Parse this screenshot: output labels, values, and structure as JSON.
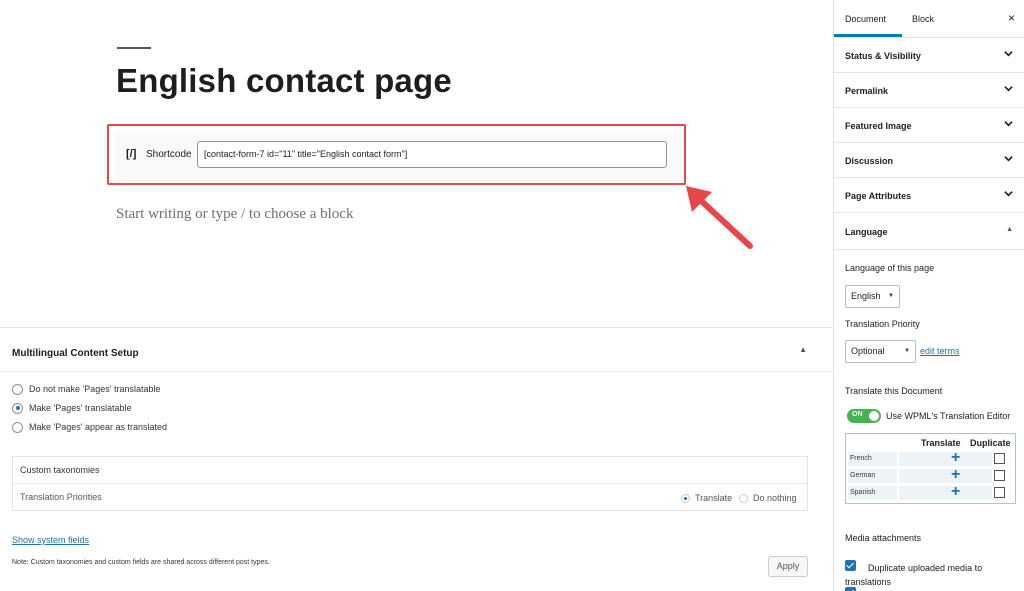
{
  "editor": {
    "post_title": "English contact page",
    "shortcode": {
      "icon": "[/]",
      "label": "Shortcode",
      "value": "[contact-form-7 id=\"11\" title=\"English contact form\"]"
    },
    "placeholder": "Start writing or type / to choose a block"
  },
  "colors": {
    "highlight": "#e8474a",
    "accent": "#007cba",
    "link": "#2271b1",
    "toggle_on": "#46b450"
  },
  "meta_box": {
    "title": "Multilingual Content Setup",
    "options": [
      {
        "label": "Do not make 'Pages' translatable",
        "selected": false
      },
      {
        "label": "Make 'Pages' translatable",
        "selected": true
      },
      {
        "label": "Make 'Pages' appear as translated",
        "selected": false
      }
    ],
    "custom_taxonomies": "Custom taxonomies",
    "translation_priorities": "Translation Priorities",
    "priority_options": [
      "Translate",
      "Do nothing"
    ],
    "show_system_fields": "Show system fields",
    "note": "Note: Custom taxonomies and custom fields are shared across different post types.",
    "apply_label": "Apply"
  },
  "sidebar": {
    "tabs": {
      "document": "Document",
      "block": "Block"
    },
    "close_icon": "×",
    "panels": [
      "Status & Visibility",
      "Permalink",
      "Featured Image",
      "Discussion",
      "Page Attributes"
    ],
    "language_panel": {
      "title": "Language",
      "language_of_page_label": "Language of this page",
      "language_value": "English",
      "translation_priority_label": "Translation Priority",
      "priority_value": "Optional",
      "edit_terms": "edit terms",
      "translate_doc_label": "Translate this Document",
      "toggle_label": "ON",
      "editor_label": "Use WPML's Translation Editor",
      "table_headers": {
        "translate": "Translate",
        "duplicate": "Duplicate"
      },
      "languages": [
        "French",
        "German",
        "Spanish"
      ],
      "plus": "+",
      "media_label": "Media attachments",
      "duplicate_media": "Duplicate uploaded media to translations"
    }
  }
}
